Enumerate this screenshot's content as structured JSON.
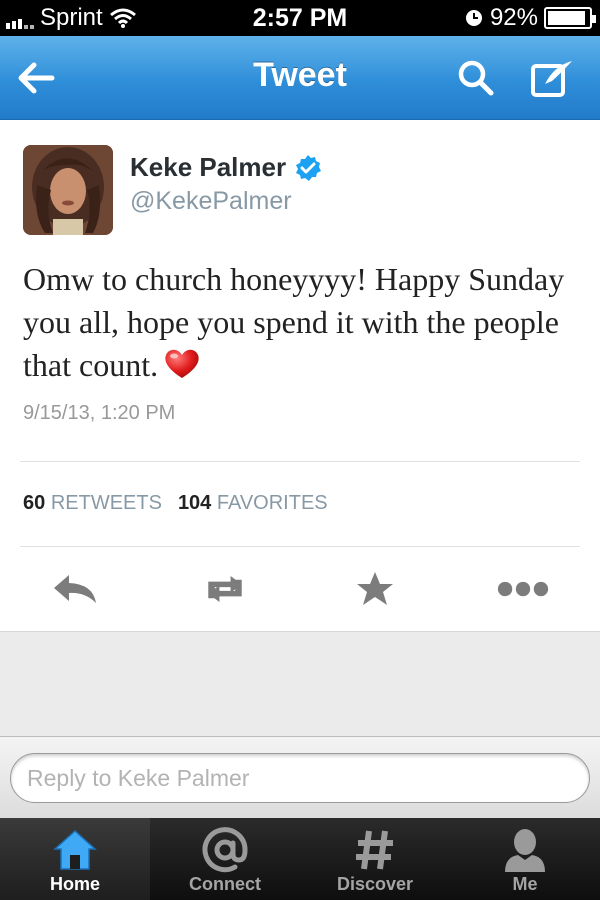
{
  "status_bar": {
    "carrier": "Sprint",
    "time": "2:57 PM",
    "battery_percent": "92%",
    "battery_level": 0.92
  },
  "nav": {
    "title": "Tweet",
    "icons": [
      "back-arrow-icon",
      "search-icon",
      "compose-icon"
    ]
  },
  "tweet": {
    "display_name": "Keke Palmer",
    "verified": true,
    "handle": "@KekePalmer",
    "text": "Omw to church honeyyyy! Happy Sunday you all, hope you spend it with the people that count.",
    "emoji": "heart",
    "timestamp": "9/15/13, 1:20 PM",
    "retweets_count": "60",
    "retweets_label": "RETWEETS",
    "favorites_count": "104",
    "favorites_label": "FAVORITES",
    "actions": [
      "reply-icon",
      "retweet-icon",
      "favorite-icon",
      "more-icon"
    ]
  },
  "reply": {
    "placeholder": "Reply to Keke Palmer"
  },
  "tabs": [
    {
      "label": "Home",
      "icon": "home-icon",
      "active": true
    },
    {
      "label": "Connect",
      "icon": "at-icon",
      "active": false
    },
    {
      "label": "Discover",
      "icon": "hashtag-icon",
      "active": false
    },
    {
      "label": "Me",
      "icon": "person-icon",
      "active": false
    }
  ],
  "colors": {
    "nav_blue": "#2f8ed9",
    "verified_blue": "#1da1f2",
    "active_tab_icon": "#3fa9f5"
  }
}
